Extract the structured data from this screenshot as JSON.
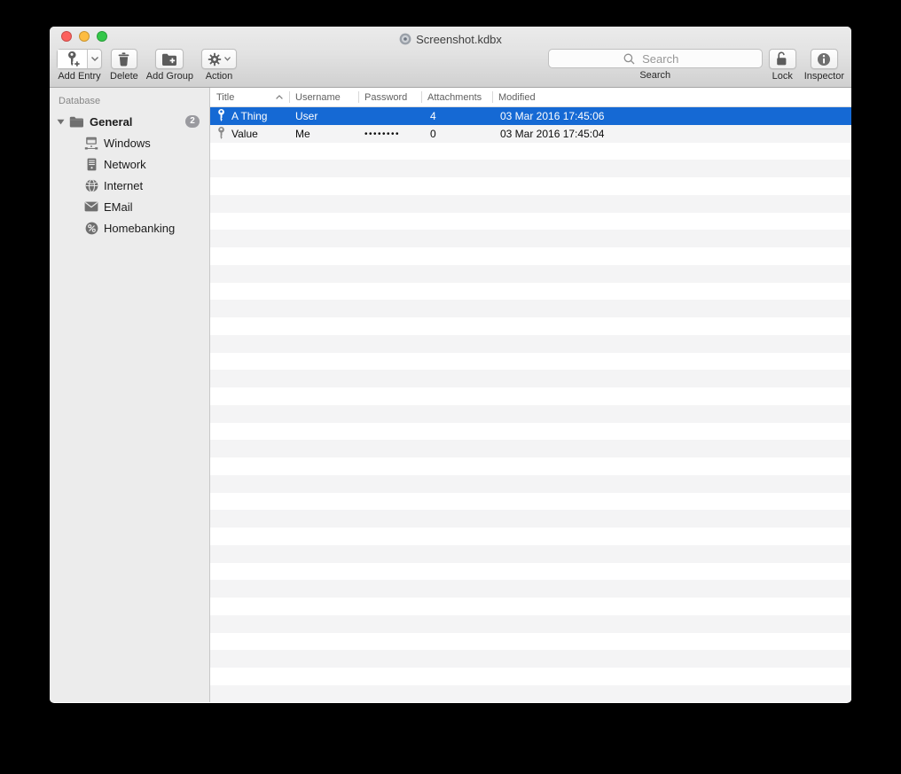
{
  "window": {
    "title": "Screenshot.kdbx"
  },
  "toolbar": {
    "add_entry_label": "Add Entry",
    "delete_label": "Delete",
    "add_group_label": "Add Group",
    "action_label": "Action",
    "search": {
      "placeholder": "Search",
      "label": "Search"
    },
    "lock_label": "Lock",
    "inspector_label": "Inspector"
  },
  "sidebar": {
    "section_header": "Database",
    "root": {
      "label": "General",
      "badge": "2"
    },
    "items": [
      {
        "label": "Windows",
        "icon": "windows-network-icon"
      },
      {
        "label": "Network",
        "icon": "server-icon"
      },
      {
        "label": "Internet",
        "icon": "globe-icon"
      },
      {
        "label": "EMail",
        "icon": "envelope-icon"
      },
      {
        "label": "Homebanking",
        "icon": "percent-circle-icon"
      }
    ]
  },
  "table": {
    "columns": [
      "Title",
      "Username",
      "Password",
      "Attachments",
      "Modified"
    ],
    "sort": {
      "column": "Title",
      "direction": "ascending"
    },
    "rows": [
      {
        "title": "A Thing",
        "username": "User",
        "password": "",
        "attachments": "4",
        "modified": "03 Mar 2016 17:45:06",
        "selected": true
      },
      {
        "title": "Value",
        "username": "Me",
        "password": "••••••••",
        "attachments": "0",
        "modified": "03 Mar 2016 17:45:04",
        "selected": false
      }
    ]
  },
  "colors": {
    "selection_blue": "#1569d4",
    "row_stripe": "#f4f4f5",
    "sidebar_background": "#ececec",
    "traffic_red": "#fc615d",
    "traffic_yellow": "#fdbc40",
    "traffic_green": "#34c749"
  },
  "icon_names": [
    "close-icon",
    "minimize-icon",
    "zoom-icon",
    "document-proxy-icon",
    "key-plus-icon",
    "chevron-down-icon",
    "trash-icon",
    "folder-plus-icon",
    "gear-icon",
    "search-icon",
    "lock-open-icon",
    "info-icon",
    "disclosure-triangle-icon",
    "folder-icon",
    "windows-network-icon",
    "server-icon",
    "globe-icon",
    "envelope-icon",
    "percent-circle-icon",
    "key-icon",
    "sort-ascending-icon"
  ]
}
